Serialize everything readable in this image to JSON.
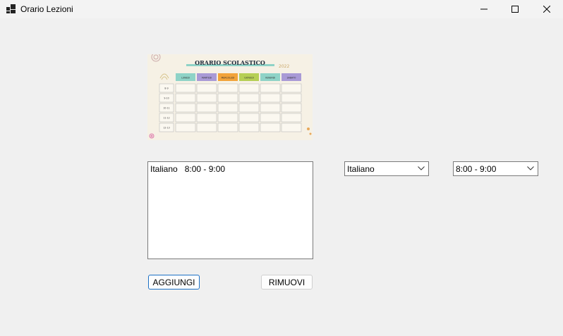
{
  "window": {
    "title": "Orario Lezioni"
  },
  "poster": {
    "title": "ORARIO SCOLASTICO",
    "accent_note": "2022",
    "days": [
      {
        "label": "LUNEDI",
        "color": "#8fd3c7"
      },
      {
        "label": "MARTEDI",
        "color": "#a99ad6"
      },
      {
        "label": "MERCOLEDI",
        "color": "#f2a33a"
      },
      {
        "label": "GIOVEDI",
        "color": "#b6cf55"
      },
      {
        "label": "VENERDI",
        "color": "#8fd3c7"
      },
      {
        "label": "SABATO",
        "color": "#a99ad6"
      }
    ],
    "times": [
      "8-9",
      "9-10",
      "10-11",
      "11-12",
      "12-13"
    ]
  },
  "lessons": {
    "items": [
      "Italiano   8:00 - 9:00"
    ]
  },
  "subject_select": {
    "value": "Italiano"
  },
  "time_select": {
    "value": "8:00 - 9:00"
  },
  "buttons": {
    "add_label": "AGGIUNGI",
    "remove_label": "RIMUOVI"
  }
}
